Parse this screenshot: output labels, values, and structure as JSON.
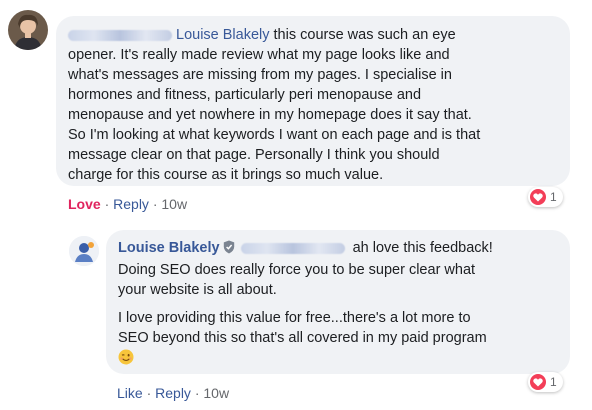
{
  "comment": {
    "author_name": "Louise Blakely",
    "text_lines": [
      "this course was such an eye",
      "opener. It's really made review what my page looks like and",
      "what's messages are missing from my pages. I specialise in",
      "hormones and fitness, particularly peri menopause and",
      "menopause and yet nowhere in my homepage does it say that.",
      "So I'm looking at what keywords I want on each page and is that",
      "message clear on that page. Personally I think you should",
      "charge for this course as it brings so much value."
    ],
    "reaction_count": "1",
    "actions": {
      "love": "Love",
      "sep1": "·",
      "reply": "Reply",
      "sep2": "·",
      "time": "10w"
    },
    "avatar_icon": "user-photo-avatar"
  },
  "reply": {
    "author_name": "Louise Blakely",
    "badge_icon": "shield-icon",
    "first_line_text": "ah love this feedback!",
    "paragraph1_lines": [
      "Doing SEO does really force you to be super clear what",
      "your website is all about."
    ],
    "paragraph2_lines": [
      "I love providing this value for free...there's a lot more to",
      "SEO beyond this so that's all covered in my paid program"
    ],
    "emoji": "😉",
    "reaction_count": "1",
    "actions": {
      "like": "Like",
      "sep1": "·",
      "reply": "Reply",
      "sep2": "·",
      "time": "10w"
    },
    "avatar_icon": "page-logo-avatar"
  },
  "colors": {
    "bubble_bg": "#f0f2f5",
    "link_blue": "#385898",
    "love_red": "#e0245e",
    "heart_badge": "#f33e58",
    "muted": "#65676b"
  }
}
